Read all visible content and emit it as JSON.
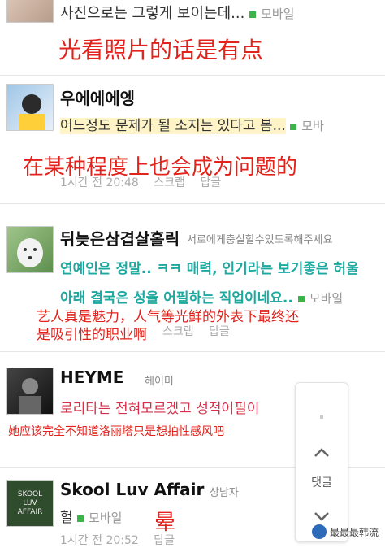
{
  "comments": [
    {
      "id": "c0",
      "text_line": "사진으로는 그렇게 보이는데...",
      "mobile_label": "모바일"
    },
    {
      "id": "c1",
      "name": "우에에에엥",
      "text_line": "어느정도 문제가 될 소지는 있다고 봄...",
      "mobile_label": "모바",
      "meta": [
        "1시간 전 20:48",
        "스크랩",
        "답글"
      ]
    },
    {
      "id": "c2",
      "name": "뒤늦은삼겹살홀릭",
      "nick": "서로에게충실할수있도록해주세요",
      "text_line1": "연예인은 정말.. ㅋㅋ 매력, 인기라는 보기좋은 허울",
      "text_line2": "아래 결국은 성을 어필하는 직업이네요..",
      "mobile_label": "모바일",
      "meta": [
        "스크랩",
        "답글"
      ]
    },
    {
      "id": "c3",
      "name": "HEYME",
      "nick": "헤이미",
      "text_line": "로리타는 전혀모르겠고 성적어필이"
    },
    {
      "id": "c4",
      "name": "Skool Luv Affair",
      "nick": "상남자",
      "text_line": "헐",
      "mobile_label": "모바일",
      "meta": [
        "1시간 전 20:52",
        "답글"
      ]
    }
  ],
  "annotations": {
    "a1": "光看照片的话是有点",
    "a2": "在某种程度上也会成为问题的",
    "a3_line1": "艺人真是魅力，人气等光鲜的外表下最终还",
    "a3_line2": "是吸引性的职业啊",
    "a4": "她应该完全不知道洛丽塔只是想拍性感风吧",
    "a5": "晕"
  },
  "side_panel": {
    "label": "댓글"
  },
  "watermark": {
    "text": "最最最韩流"
  },
  "avatar_labels": {
    "skool": "SKOOL LUV AFFAIR"
  }
}
